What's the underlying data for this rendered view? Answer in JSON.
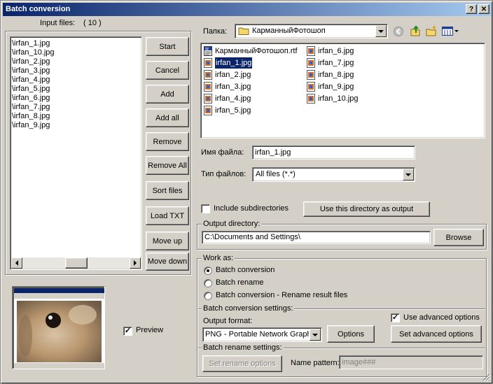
{
  "window": {
    "title": "Batch conversion",
    "help_label": "?",
    "close_label": "✕"
  },
  "input": {
    "label": "Input files:",
    "count": "( 10 )",
    "files": [
      "\\irfan_1.jpg",
      "\\irfan_10.jpg",
      "\\irfan_2.jpg",
      "\\irfan_3.jpg",
      "\\irfan_4.jpg",
      "\\irfan_5.jpg",
      "\\irfan_6.jpg",
      "\\irfan_7.jpg",
      "\\irfan_8.jpg",
      "\\irfan_9.jpg"
    ]
  },
  "buttons": {
    "start": "Start",
    "cancel": "Cancel",
    "add": "Add",
    "add_all": "Add all",
    "remove": "Remove",
    "remove_all": "Remove All",
    "sort_files": "Sort files",
    "load_txt": "Load TXT",
    "move_up": "Move up",
    "move_down": "Move down"
  },
  "preview": {
    "label": "Preview",
    "checked": true
  },
  "folder": {
    "label": "Папка:",
    "value": "КарманныйФотошоп"
  },
  "browser": {
    "col1": [
      {
        "name": "КарманныйФотошоп.rtf",
        "icon": "rtf-document-icon"
      },
      {
        "name": "irfan_1.jpg",
        "icon": "jpg-file-icon",
        "selected": true
      },
      {
        "name": "irfan_2.jpg",
        "icon": "jpg-file-icon"
      },
      {
        "name": "irfan_3.jpg",
        "icon": "jpg-file-icon"
      },
      {
        "name": "irfan_4.jpg",
        "icon": "jpg-file-icon"
      },
      {
        "name": "irfan_5.jpg",
        "icon": "jpg-file-icon"
      }
    ],
    "col2": [
      {
        "name": "irfan_6.jpg",
        "icon": "jpg-file-icon"
      },
      {
        "name": "irfan_7.jpg",
        "icon": "jpg-file-icon"
      },
      {
        "name": "irfan_8.jpg",
        "icon": "jpg-file-icon"
      },
      {
        "name": "irfan_9.jpg",
        "icon": "jpg-file-icon"
      },
      {
        "name": "irfan_10.jpg",
        "icon": "jpg-file-icon"
      }
    ]
  },
  "filename": {
    "label": "Имя файла:",
    "value": "irfan_1.jpg"
  },
  "filetype": {
    "label": "Тип файлов:",
    "value": "All files (*.*)"
  },
  "include_subdirs": {
    "label": "Include subdirectories",
    "checked": false
  },
  "use_dir_button": "Use this directory as output",
  "output": {
    "label": "Output directory:",
    "value": "C:\\Documents and Settings\\",
    "browse": "Browse"
  },
  "work_as": {
    "label": "Work as:",
    "options": [
      "Batch conversion",
      "Batch rename",
      "Batch conversion - Rename result files"
    ],
    "selected": 0
  },
  "conversion": {
    "label": "Batch conversion settings:",
    "format_label": "Output format:",
    "format_value": "PNG - Portable Network Graphics",
    "options_button": "Options",
    "advanced_label": "Use advanced options",
    "advanced_checked": true,
    "set_advanced_button": "Set advanced options"
  },
  "rename": {
    "label": "Batch rename settings:",
    "set_button": "Set rename options",
    "pattern_label": "Name pattern:",
    "pattern_value": "image###"
  },
  "colors": {
    "title_start": "#0a246a",
    "title_end": "#a6caf0",
    "selection": "#0a246a",
    "face": "#d4d0c8"
  }
}
